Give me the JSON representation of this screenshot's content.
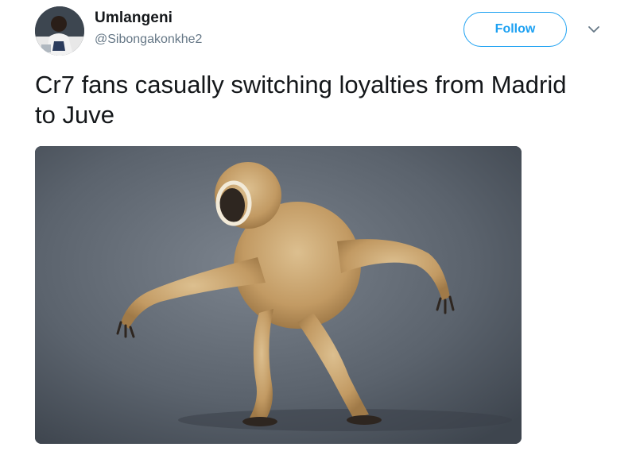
{
  "tweet": {
    "author": {
      "display_name": "Umlangeni",
      "handle": "@Sibongakonkhe2"
    },
    "follow_label": "Follow",
    "text": "Cr7 fans casually switching loyalties from Madrid to Juve",
    "media": {
      "subject": "gibbon-walking-photo"
    }
  },
  "colors": {
    "accent": "#1da1f2",
    "secondary_text": "#657786",
    "primary_text": "#14171a"
  },
  "icons": {
    "more_menu": "chevron-down-icon"
  }
}
